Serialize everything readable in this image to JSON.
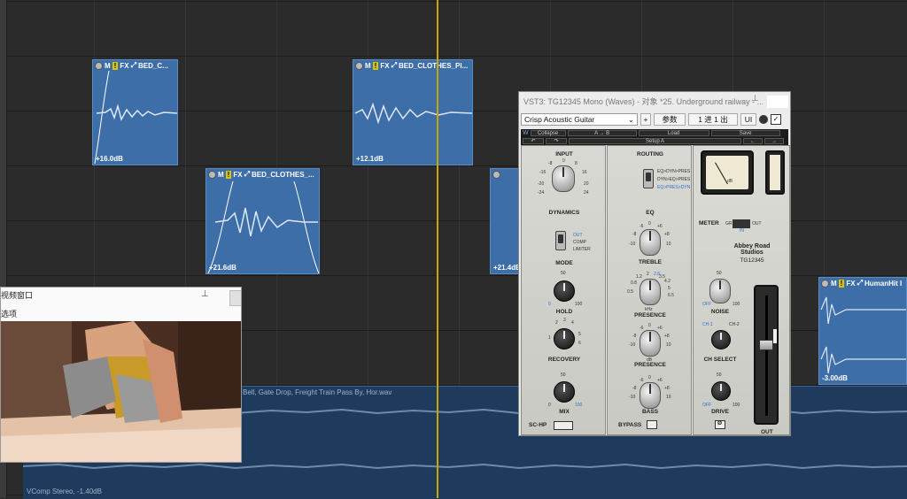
{
  "arrange": {
    "clips": [
      {
        "name": "BED_C...",
        "gain": "+16.0dB"
      },
      {
        "name": "BED_CLOTHES_PI...",
        "gain": "+12.1dB"
      },
      {
        "name": "BED_CLOTHES_...",
        "gain": "+21.6dB"
      },
      {
        "name": "",
        "gain": "+21.4dB"
      },
      {
        "name": "HumanHit I",
        "gain": "-3.00dB"
      }
    ],
    "clip_flags": {
      "mute": "M",
      "warn": "!",
      "fx": "FX"
    },
    "long_clip_name": "Bell, Gate Drop, Freight Train Pass By, Hor.wav",
    "long_clip_footer": "VComp Stereo,  -1.40dB",
    "colors": {
      "clip": "#3d6ea8",
      "playhead": "#c8a800",
      "background": "#2b2b2b"
    }
  },
  "video_window": {
    "title": "视频窗口",
    "options": "选项",
    "pin_icon": "pin-icon"
  },
  "plugin": {
    "title": "VST3: TG12345 Mono (Waves) - 对象 *25. Underground railway - ...",
    "preset": "Crisp Acoustic Guitar",
    "plus": "+",
    "params": "参数",
    "io": "1 进 1 出",
    "ui": "UI",
    "check": "✓",
    "waves_bar": {
      "collapse": "Collapse",
      "ab": "A → B",
      "load": "Load",
      "save": "Save",
      "setup": "Setup A"
    },
    "input": {
      "title": "INPUT",
      "scale": [
        "-8",
        "0",
        "8",
        "-16",
        "16",
        "-20",
        "20",
        "-24",
        "24"
      ]
    },
    "dynamics": {
      "title": "DYNAMICS",
      "opts": [
        "OUT",
        "COMP",
        "LIMITER"
      ],
      "mode": "MODE",
      "hold": "HOLD",
      "hold_scale": [
        "50",
        "0",
        "100"
      ],
      "recovery": "RECOVERY",
      "recovery_scale": [
        "2",
        "3",
        "4",
        "1",
        "5",
        "6"
      ],
      "mix": "MIX",
      "mix_scale": [
        "50",
        "0",
        "100"
      ],
      "schp": "SC-HP"
    },
    "routing": {
      "title": "ROUTING",
      "opts": [
        "EQ>DYN>PRES",
        "DYN>EQ>PRES",
        "EQ>PRES>DYN"
      ]
    },
    "eq": {
      "title": "EQ",
      "treble": "TREBLE",
      "treble_scale": [
        "-6",
        "0",
        "+6",
        "-8",
        "+8",
        "-10",
        "10"
      ],
      "presence_khz": "kHz",
      "presence": "PRESENCE",
      "presence_scale": [
        "1.2",
        "2",
        "2.8",
        "3.5",
        "4.2",
        "0.8",
        "5",
        "0.5",
        "6.5"
      ],
      "presence_db": "dB",
      "presence2": "PRESENCE",
      "presence2_scale": [
        "-6",
        "0",
        "+6",
        "-8",
        "+8",
        "-10",
        "10"
      ],
      "bass": "BASS",
      "bass_scale": [
        "-6",
        "0",
        "+6",
        "-8",
        "+8",
        "-10",
        "10"
      ],
      "bypass": "BYPASS"
    },
    "output": {
      "meter": "METER",
      "meter_opts": [
        "GR",
        "IN",
        "OUT"
      ],
      "meter_face": "dB",
      "brand": "Abbey Road",
      "brand2": "Studios",
      "model": "TG12345",
      "noise": "NOISE",
      "noise_scale": [
        "50",
        "OFF",
        "100"
      ],
      "ch_select": "CH SELECT",
      "ch_opts": [
        "CH-1",
        "CH-2"
      ],
      "drive": "DRIVE",
      "drive_scale": [
        "50",
        "OFF",
        "100"
      ],
      "phase": "Ø",
      "out": "OUT"
    }
  }
}
